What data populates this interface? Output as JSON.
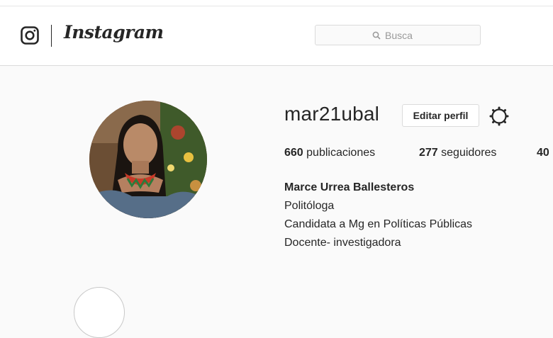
{
  "header": {
    "logo_name": "instagram-camera-icon",
    "wordmark": "Instagram",
    "search": {
      "placeholder": "Busca"
    }
  },
  "profile": {
    "username": "mar21ubal",
    "edit_button": "Editar perfil",
    "stats": {
      "posts_count": "660",
      "posts_label": "publicaciones",
      "followers_count": "277",
      "followers_label": "seguidores",
      "following_count": "40"
    },
    "bio": {
      "full_name": "Marce Urrea Ballesteros",
      "lines": [
        "Politóloga",
        "Candidata a Mg en Políticas Públicas",
        "Docente- investigadora"
      ]
    }
  },
  "colors": {
    "text": "#262626",
    "border": "#dbdbdb",
    "background": "#fafafa"
  }
}
